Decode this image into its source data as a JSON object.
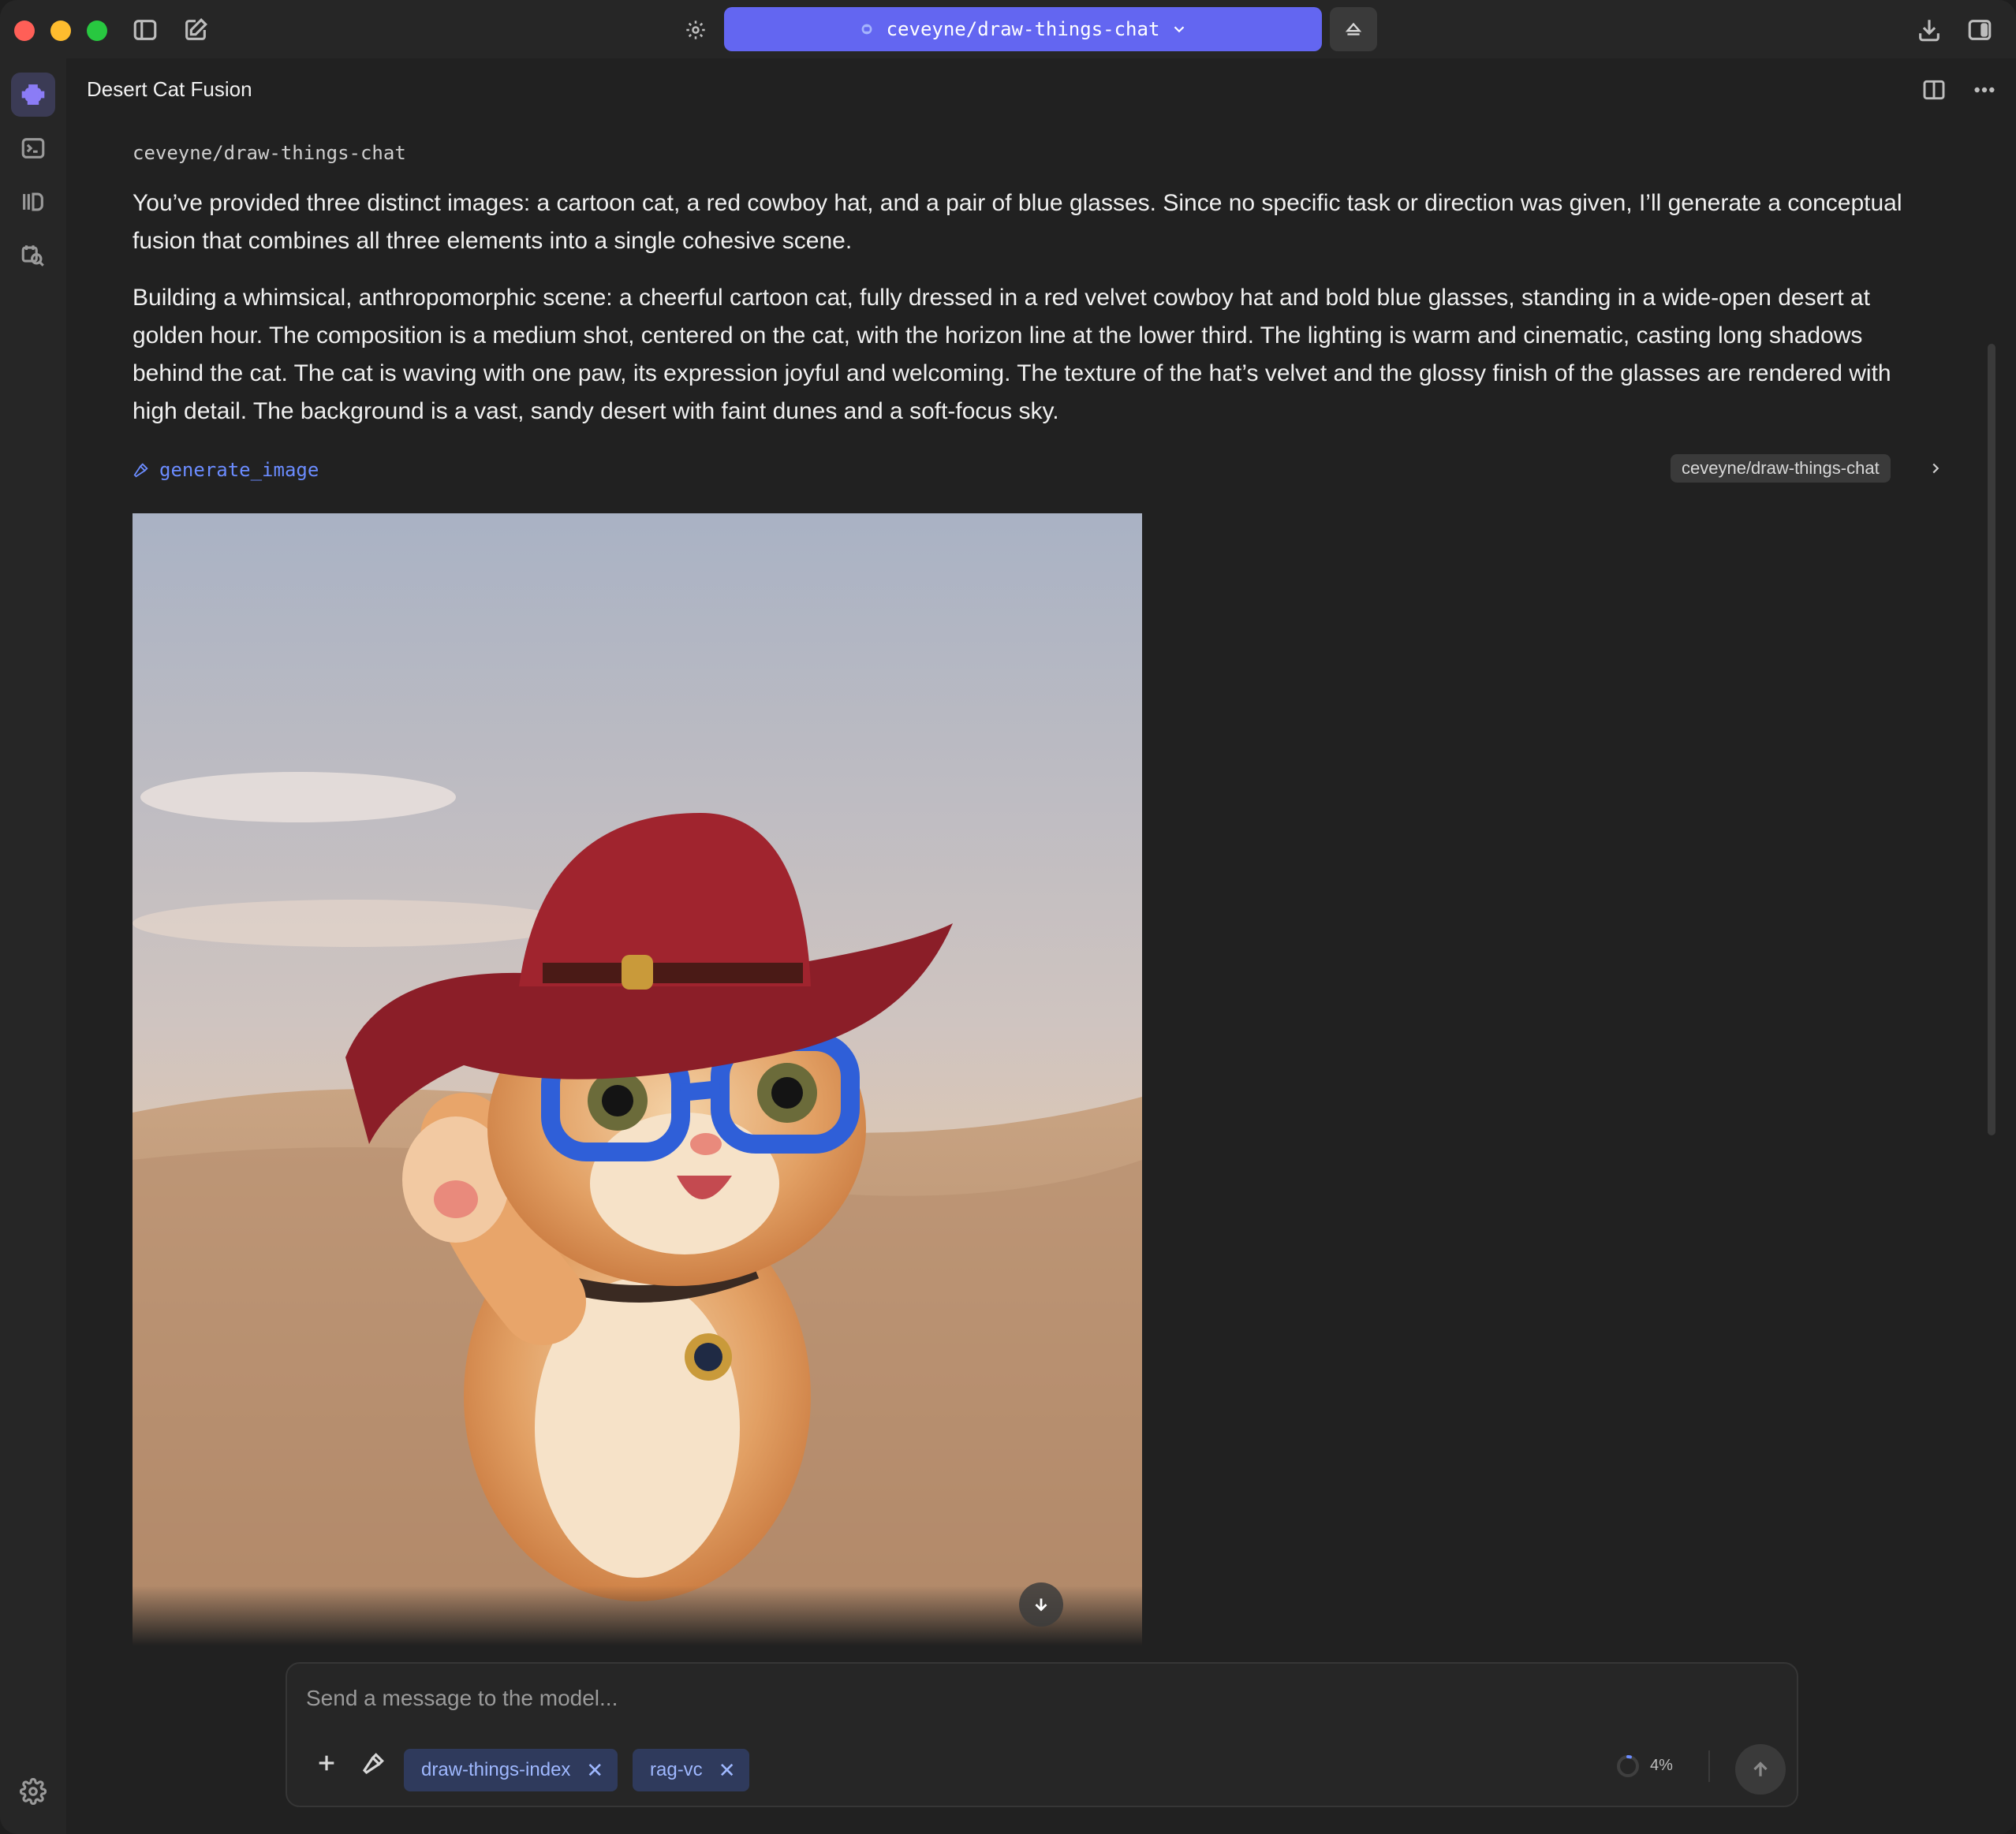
{
  "titlebar": {
    "model_name": "ceveyne/draw-things-chat"
  },
  "header": {
    "chat_title": "Desert Cat Fusion"
  },
  "message": {
    "sender": "ceveyne/draw-things-chat",
    "paragraph_1": "You’ve provided three distinct images: a cartoon cat, a red cowboy hat, and a pair of blue glasses. Since no specific task or direction was given, I’ll generate a conceptual fusion that combines all three elements into a single cohesive scene.",
    "paragraph_2": "Building a whimsical, anthropomorphic scene: a cheerful cartoon cat, fully dressed in a red velvet cowboy hat and bold blue glasses, standing in a wide-open desert at golden hour. The composition is a medium shot, centered on the cat, with the horizon line at the lower third. The lighting is warm and cinematic, casting long shadows behind the cat. The cat is waving with one paw, its expression joyful and welcoming. The texture of the hat’s velvet and the glossy finish of the glasses are rendered with high detail. The background is a vast, sandy desert with faint dunes and a soft-focus sky.",
    "tool_call": {
      "name": "generate_image",
      "server": "ceveyne/draw-things-chat"
    }
  },
  "composer": {
    "placeholder": "Send a message to the model...",
    "chips": [
      {
        "label": "draw-things-index"
      },
      {
        "label": "rag-vc"
      }
    ],
    "context_usage": "4%",
    "context_fraction": 0.04
  },
  "icons": {
    "rail": [
      "assistant-icon",
      "terminal-icon",
      "library-icon",
      "search-docs-icon",
      "settings-icon"
    ],
    "titlebar": [
      "sidebar-toggle-icon",
      "compose-icon",
      "gear-icon",
      "chevron-down-icon",
      "eject-icon",
      "download-icon",
      "right-panel-icon"
    ],
    "header": [
      "split-view-icon",
      "more-icon"
    ]
  },
  "colors": {
    "accent": "#6366f1",
    "tool_link": "#6b8cff",
    "chip_bg": "#2f3a5c",
    "chip_text": "#9fb8ff"
  }
}
